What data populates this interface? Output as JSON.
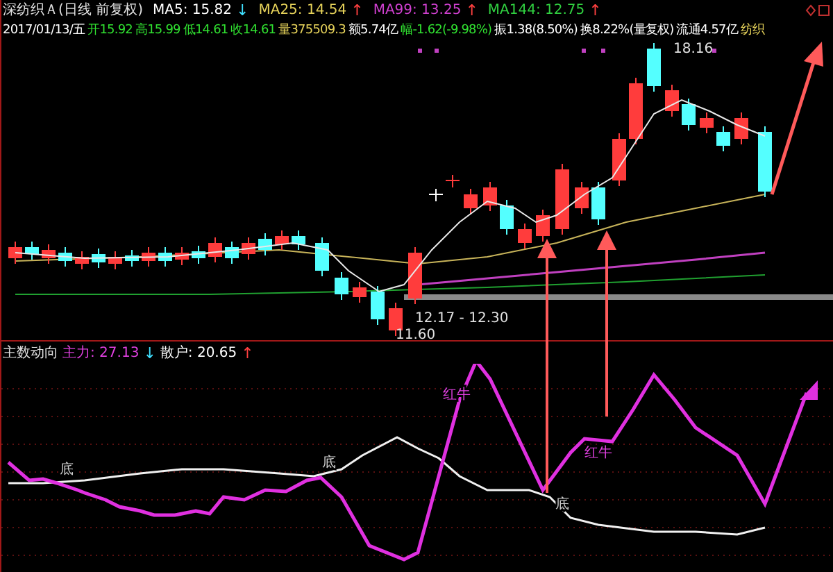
{
  "header": {
    "title": "深纺织Ａ(日线 前复权)",
    "mas": [
      {
        "label": "MA5: 15.82",
        "color": "#ffffff",
        "arrow": {
          "text": "↓",
          "color": "#40e0ff"
        }
      },
      {
        "label": "MA25: 14.54",
        "color": "#e6d25a",
        "arrow": {
          "text": "↑",
          "color": "#ff4040"
        }
      },
      {
        "label": "MA99: 13.25",
        "color": "#d040d0",
        "arrow": {
          "text": "↑",
          "color": "#ff4040"
        }
      },
      {
        "label": "MA144: 12.75",
        "color": "#30d040",
        "arrow": {
          "text": "↑",
          "color": "#ff4040"
        }
      }
    ]
  },
  "quote": [
    {
      "text": "2017/01/13/五",
      "color": "#ffffff"
    },
    {
      "text": "开15.92",
      "color": "#30e030"
    },
    {
      "text": "高15.99",
      "color": "#30e030"
    },
    {
      "text": "低14.61",
      "color": "#30e030"
    },
    {
      "text": "收14.61",
      "color": "#30e030"
    },
    {
      "text": "量375509.3",
      "color": "#e6d25a"
    },
    {
      "text": "额5.74亿",
      "color": "#ffffff"
    },
    {
      "text": "幅-1.62(-9.98%)",
      "color": "#30e030"
    },
    {
      "text": "振1.38(8.50%)",
      "color": "#ffffff"
    },
    {
      "text": "换8.22%(量复权)",
      "color": "#ffffff"
    },
    {
      "text": "流通4.57亿",
      "color": "#ffffff"
    },
    {
      "text": "纺织",
      "color": "#e6d25a"
    }
  ],
  "price_labels": [
    "18.16",
    "12.17 - 12.30",
    "11.60"
  ],
  "indicator": {
    "name": "主数动向",
    "lines": [
      {
        "label": "主力: 27.13",
        "color": "#e040e0",
        "arrow": {
          "text": "↓",
          "color": "#40e0ff"
        }
      },
      {
        "label": "散户: 20.65",
        "color": "#ffffff",
        "arrow": {
          "text": "↑",
          "color": "#ff4040"
        }
      }
    ]
  },
  "signals": [
    "红牛",
    "红牛"
  ],
  "cross_labels": [
    "底",
    "底",
    "底"
  ]
}
